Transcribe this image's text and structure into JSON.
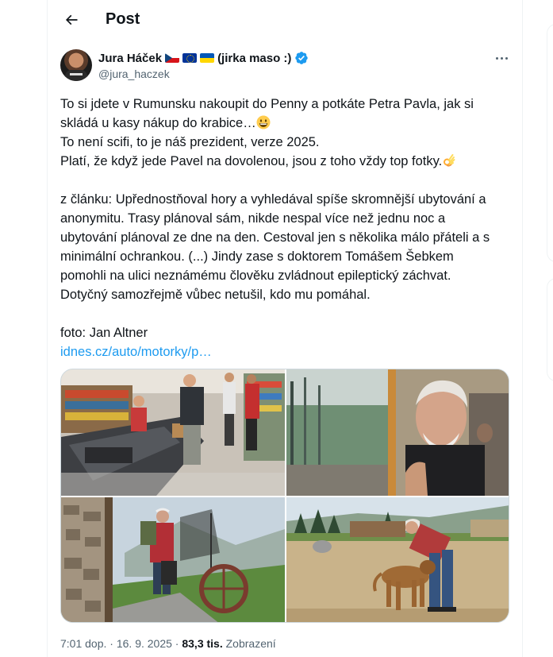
{
  "header": {
    "title": "Post"
  },
  "author": {
    "display_name": "Jura Háček",
    "name_suffix": "(jirka maso :)",
    "handle": "@jura_haczek",
    "flags": [
      "czech-flag",
      "eu-flag",
      "ukraine-flag"
    ],
    "verified": true
  },
  "tweet": {
    "lines1": [
      "To si jdete v Rumunsku nakoupit do Penny a potkáte Petra Pavla, jak si",
      "skládá u kasy nákup do krabice…",
      "To není scifi, to je náš prezident, verze 2025.",
      "Platí, že když jede Pavel na dovolenou, jsou z toho vždy top fotky."
    ],
    "lines2": [
      "z článku: Upřednostňoval hory a vyhledával spíše skromnější ubytování a",
      "anonymitu. Trasy plánoval sám, nikde nespal více než jednu noc a",
      "ubytování plánoval ze dne na den. Cestoval jen s několika málo přáteli a s",
      "minimální ochrankou. (...) Jindy zase s doktorem Tomášem Šebkem",
      "pomohli na ulici neznámému člověku zvládnout epileptický záchvat.",
      "Dotyčný samozřejmě vůbec netušil, kdo mu pomáhal."
    ],
    "photo_credit": "foto: Jan Altner",
    "link_text": "idnes.cz/auto/motorky/p…"
  },
  "media": [
    {
      "name": "supermarket-checkout-photo"
    },
    {
      "name": "train-window-photo"
    },
    {
      "name": "mountain-hiker-photo"
    },
    {
      "name": "dog-meadow-photo"
    }
  ],
  "meta": {
    "time": "7:01 dop.",
    "separator": " · ",
    "date": "16. 9. 2025",
    "views_count": "83,3 tis.",
    "views_label": "Zobrazení"
  },
  "colors": {
    "accent": "#1d9bf0",
    "text": "#0f1419",
    "muted": "#536471",
    "border": "#cfd9de"
  }
}
